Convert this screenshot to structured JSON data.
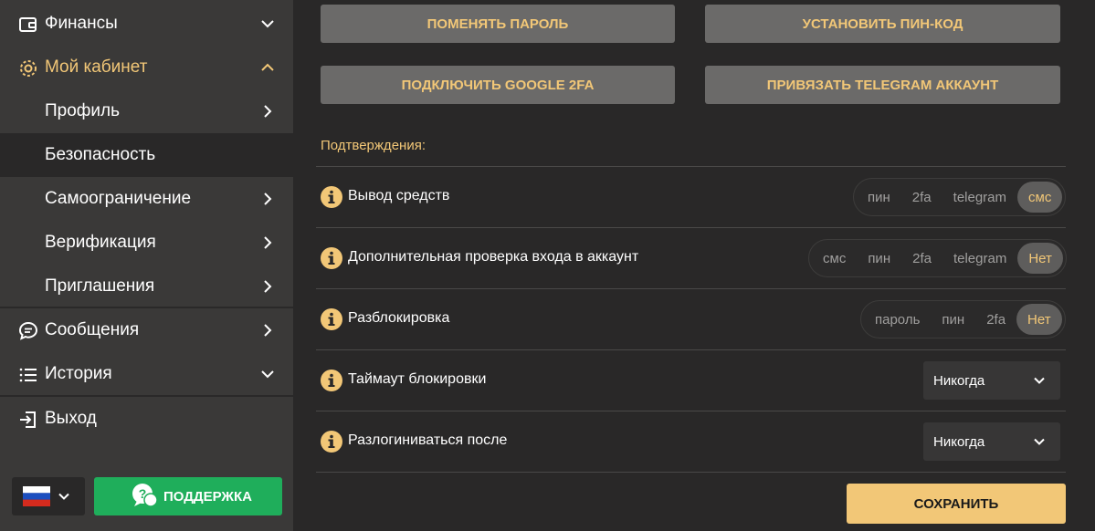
{
  "sidebar": {
    "finance": "Финансы",
    "cabinet": "Мой кабинет",
    "profile": "Профиль",
    "security": "Безопасность",
    "selflimit": "Самоограничение",
    "verification": "Верификация",
    "invites": "Приглашения",
    "messages": "Сообщения",
    "history": "История",
    "logout": "Выход",
    "support": "ПОДДЕРЖКА"
  },
  "actions": {
    "change_password": "Поменять пароль",
    "set_pin": "Установить пин-код",
    "google_2fa": "Подключить Google 2FA",
    "telegram": "Привязать Telegram аккаунт"
  },
  "confirmations": {
    "title": "Подтверждения:",
    "rows": [
      {
        "label": "Вывод средств",
        "options": [
          "пин",
          "2fa",
          "telegram",
          "смс"
        ],
        "selected": 3
      },
      {
        "label": "Дополнительная проверка входа в аккаунт",
        "options": [
          "смс",
          "пин",
          "2fa",
          "telegram",
          "Нет"
        ],
        "selected": 4
      },
      {
        "label": "Разблокировка",
        "options": [
          "пароль",
          "пин",
          "2fa",
          "Нет"
        ],
        "selected": 3
      }
    ],
    "lock_timeout": {
      "label": "Таймаут блокировки",
      "value": "Никогда"
    },
    "logout_after": {
      "label": "Разлогиниваться после",
      "value": "Никогда"
    }
  },
  "save_label": "СОХРАНИТЬ",
  "colors": {
    "accent": "#f2c777",
    "support": "#1fae5b",
    "sidebar": "#3a3938",
    "background": "#292828"
  }
}
